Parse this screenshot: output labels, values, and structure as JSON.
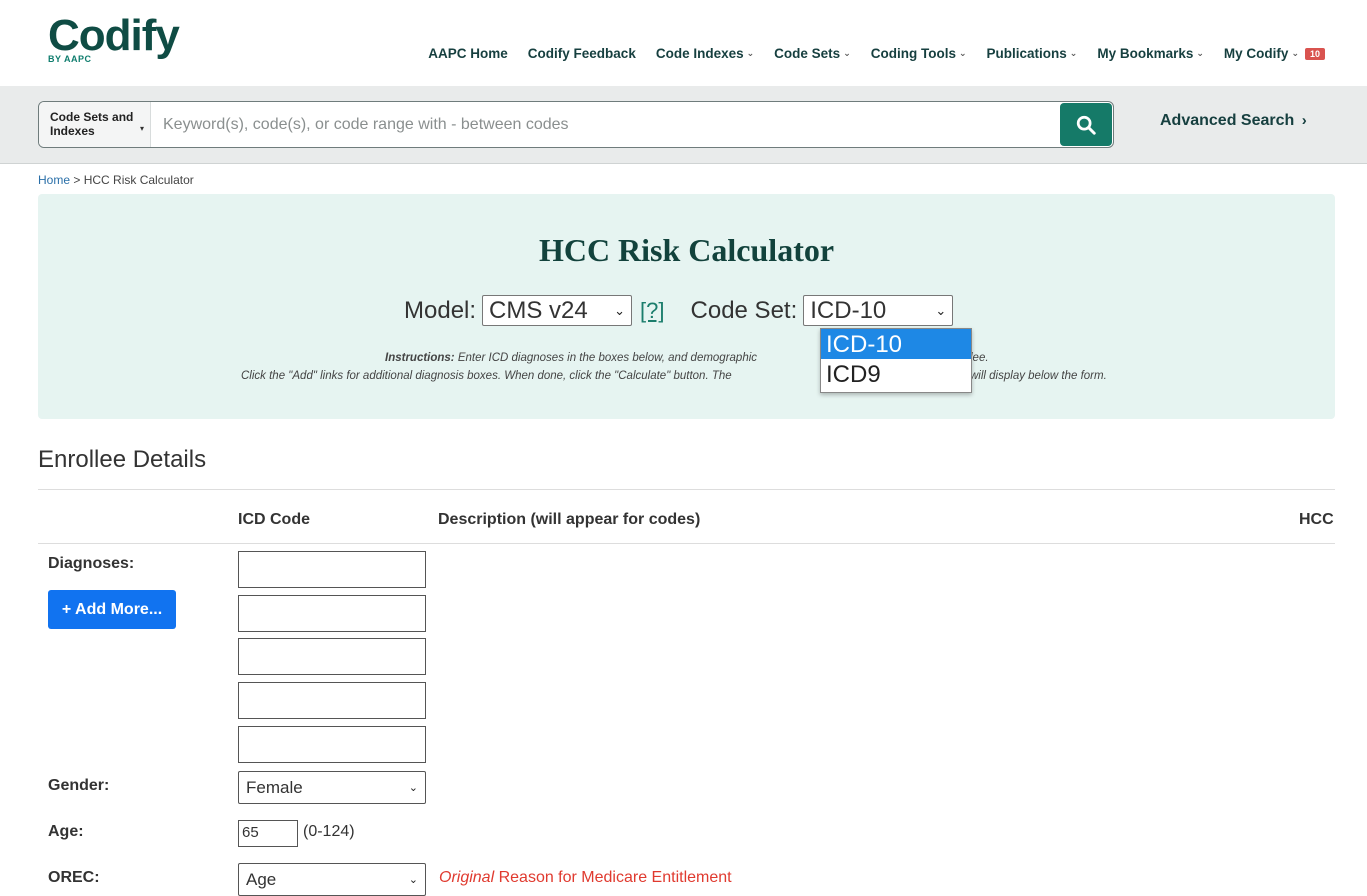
{
  "header": {
    "logo_text": "Codify",
    "logo_sub": "BY AAPC",
    "nav": [
      {
        "label": "AAPC Home",
        "has_chevron": false
      },
      {
        "label": "Codify Feedback",
        "has_chevron": false
      },
      {
        "label": "Code Indexes",
        "has_chevron": true
      },
      {
        "label": "Code Sets",
        "has_chevron": true
      },
      {
        "label": "Coding Tools",
        "has_chevron": true
      },
      {
        "label": "Publications",
        "has_chevron": true
      },
      {
        "label": "My Bookmarks",
        "has_chevron": true
      },
      {
        "label": "My Codify",
        "has_chevron": true,
        "badge": "10"
      }
    ]
  },
  "search": {
    "scope_label": "Code Sets and Indexes",
    "placeholder": "Keyword(s), code(s), or code range with - between codes",
    "button_icon": "search-icon",
    "advanced_label": "Advanced Search"
  },
  "breadcrumb": {
    "home": "Home",
    "separator": ">",
    "current": "HCC Risk Calculator"
  },
  "calculator": {
    "title": "HCC Risk Calculator",
    "model_label": "Model:",
    "model_value": "CMS v24",
    "help_link": "[?]",
    "codeset_label": "Code Set:",
    "codeset_value": "ICD-10",
    "codeset_options": [
      "ICD-10",
      "ICD9"
    ],
    "instructions_bold": "Instructions:",
    "instructions_line1": "Enter ICD diagnoses in the boxes below, and demographic",
    "instructions_line1_end": "lee.",
    "instructions_line2": "Click the \"Add\" links for additional diagnosis boxes. When done, click the \"Calculate\" button. The",
    "instructions_line2_end": "will display below the form."
  },
  "enrollee": {
    "title": "Enrollee Details",
    "col_icd": "ICD Code",
    "col_desc": "Description (will appear for codes)",
    "col_hcc": "HCC",
    "diagnoses_label": "Diagnoses:",
    "add_more_label": "+ Add More...",
    "gender_label": "Gender:",
    "gender_value": "Female",
    "age_label": "Age:",
    "age_value": "65",
    "age_hint": "(0-124)",
    "orec_label": "OREC:",
    "orec_value": "Age",
    "orec_note_italic": "Original",
    "orec_note_rest": " Reason for Medicare Entitlement"
  },
  "colors": {
    "brand_dark": "#0f4c44",
    "brand_green": "#157a68",
    "panel_bg": "#e6f4f1",
    "primary_blue": "#1173f0",
    "alert_red": "#e03a2f",
    "badge_red": "#d9534f"
  }
}
